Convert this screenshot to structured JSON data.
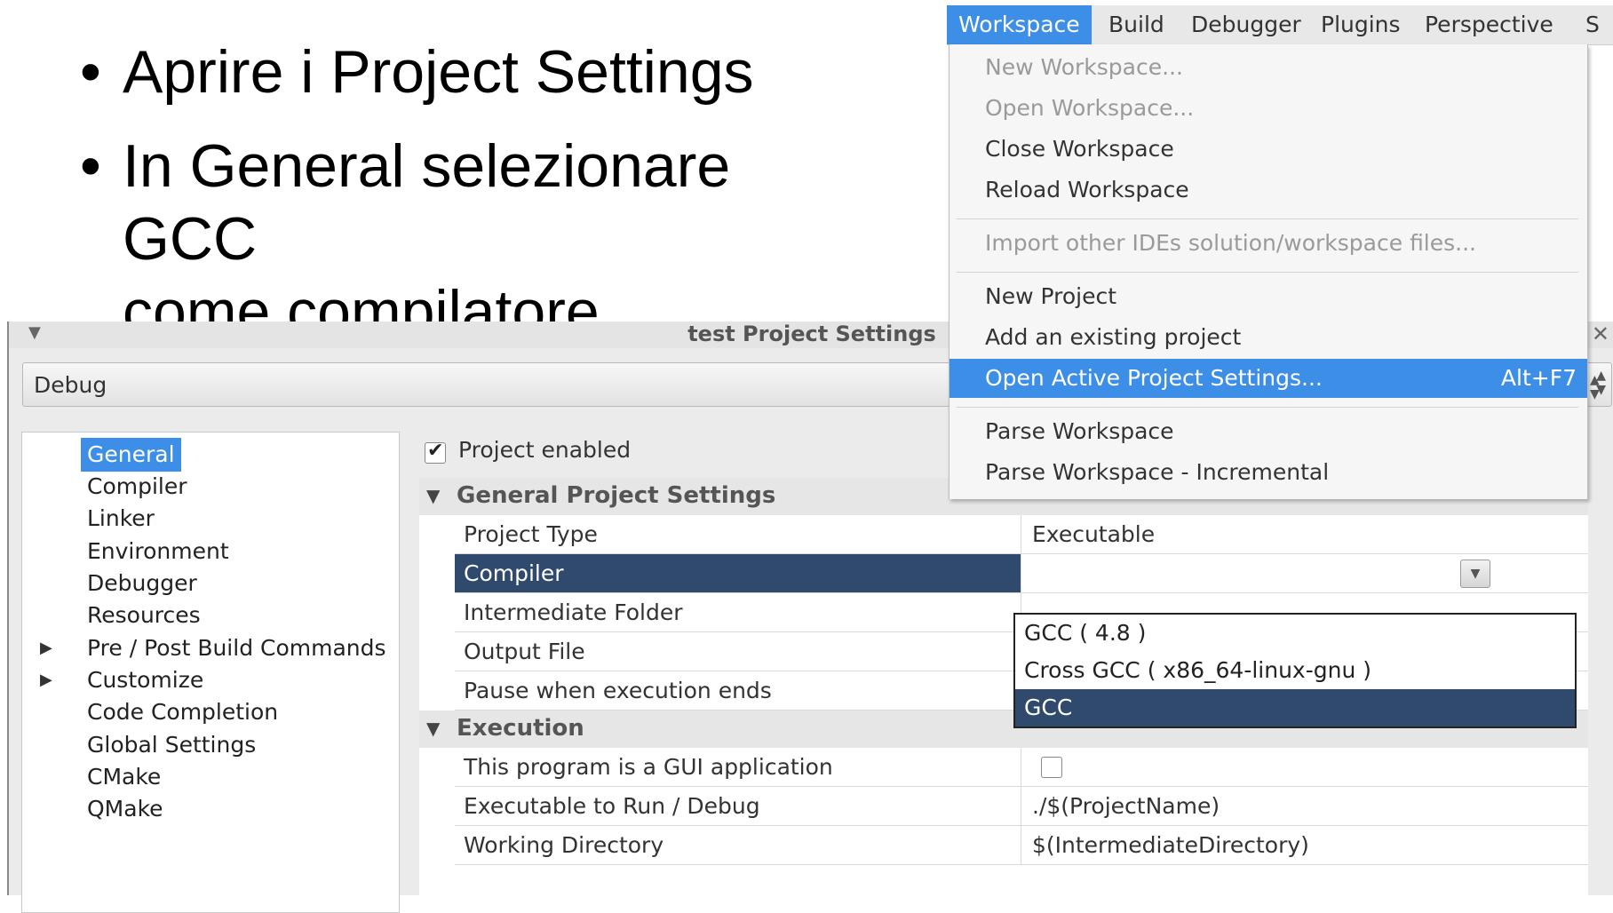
{
  "slide": {
    "bullet_char": "•",
    "bullets": [
      {
        "lines": [
          "Aprire i Project Settings"
        ]
      },
      {
        "lines": [
          "In General selezionare GCC",
          "come compilatore"
        ]
      }
    ]
  },
  "dialog": {
    "title": "test Project Settings",
    "close": "✕",
    "config": "Debug",
    "tree": [
      {
        "label": "General",
        "selected": true
      },
      {
        "label": "Compiler"
      },
      {
        "label": "Linker"
      },
      {
        "label": "Environment"
      },
      {
        "label": "Debugger"
      },
      {
        "label": "Resources"
      },
      {
        "label": "Pre / Post Build Commands",
        "expandable": true
      },
      {
        "label": "Customize",
        "expandable": true
      },
      {
        "label": "Code Completion"
      },
      {
        "label": "Global Settings"
      },
      {
        "label": "CMake"
      },
      {
        "label": "QMake"
      }
    ],
    "project_enabled": "Project enabled",
    "sections": {
      "general": "General Project Settings",
      "execution": "Execution"
    },
    "rows": {
      "project_type": {
        "name": "Project Type",
        "value": "Executable"
      },
      "compiler": {
        "name": "Compiler",
        "value": ""
      },
      "intermediate": {
        "name": "Intermediate Folder"
      },
      "output": {
        "name": "Output File"
      },
      "pause": {
        "name": "Pause when execution ends"
      },
      "gui": {
        "name": "This program is a GUI application"
      },
      "exec_run": {
        "name": "Executable to Run / Debug",
        "value": "./$(ProjectName)"
      },
      "workdir": {
        "name": "Working Directory",
        "value": "$(IntermediateDirectory)"
      }
    },
    "compiler_options": [
      "GCC ( 4.8 )",
      "Cross GCC ( x86_64-linux-gnu )",
      "GCC"
    ],
    "compiler_selected_index": 2
  },
  "menubar": {
    "items": [
      "Workspace",
      "Build",
      "Debugger",
      "Plugins",
      "Perspective",
      "S"
    ],
    "active": "Workspace"
  },
  "workspace_menu": {
    "new_workspace": "New Workspace...",
    "open_workspace": "Open Workspace...",
    "close_workspace": "Close Workspace",
    "reload_workspace": "Reload Workspace",
    "import_other": "Import other IDEs solution/workspace files...",
    "new_project": "New Project",
    "add_existing": "Add an existing project",
    "open_active_settings": "Open Active Project Settings...",
    "open_active_shortcut": "Alt+F7",
    "parse_workspace": "Parse Workspace",
    "parse_incremental": "Parse Workspace - Incremental"
  },
  "colors": {
    "menu_highlight": "#3d8ee6",
    "selection_dark": "#2f4a6c"
  }
}
